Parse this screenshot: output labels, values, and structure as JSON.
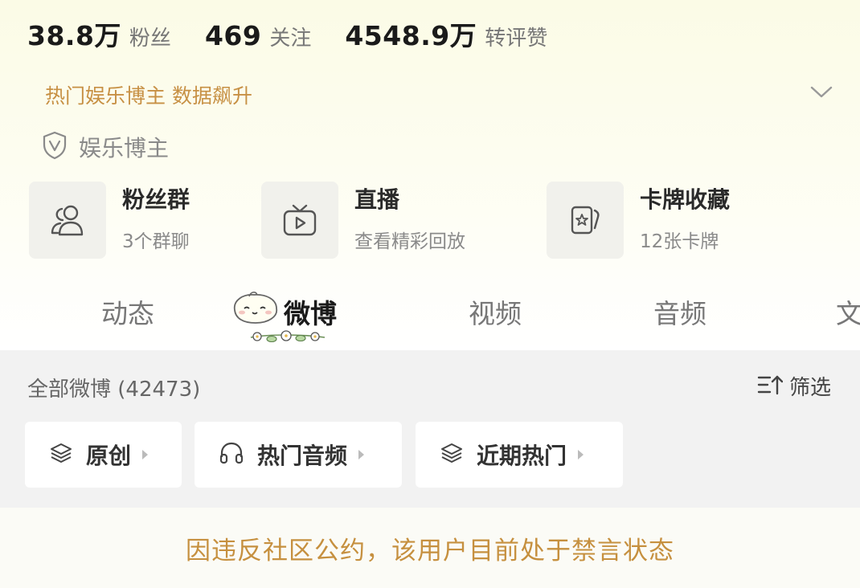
{
  "stats": [
    {
      "value": "38.8万",
      "label": "粉丝"
    },
    {
      "value": "469",
      "label": "关注"
    },
    {
      "value": "4548.9万",
      "label": "转评赞"
    }
  ],
  "hot_banner": "热门娱乐博主 数据飙升",
  "verify_tag": "娱乐博主",
  "cards": [
    {
      "title": "粉丝群",
      "sub": "3个群聊",
      "icon": "people-icon"
    },
    {
      "title": "直播",
      "sub": "查看精彩回放",
      "icon": "tv-icon"
    },
    {
      "title": "卡牌收藏",
      "sub": "12张卡牌",
      "icon": "card-icon"
    }
  ],
  "tabs": [
    "动态",
    "微博",
    "视频",
    "音频",
    "文"
  ],
  "active_tab": "微博",
  "feed": {
    "title": "全部微博 (42473)",
    "filter_label": "筛选",
    "chips": [
      {
        "label": "原创",
        "icon": "layers-icon"
      },
      {
        "label": "热门音频",
        "icon": "headphones-icon"
      },
      {
        "label": "近期热门",
        "icon": "layers-icon"
      }
    ]
  },
  "notice": "因违反社区公约，该用户目前处于禁言状态",
  "colors": {
    "accent_gold": "#c79044",
    "header_bg": "#fbfbe6",
    "feed_bg": "#f2f2f2"
  }
}
